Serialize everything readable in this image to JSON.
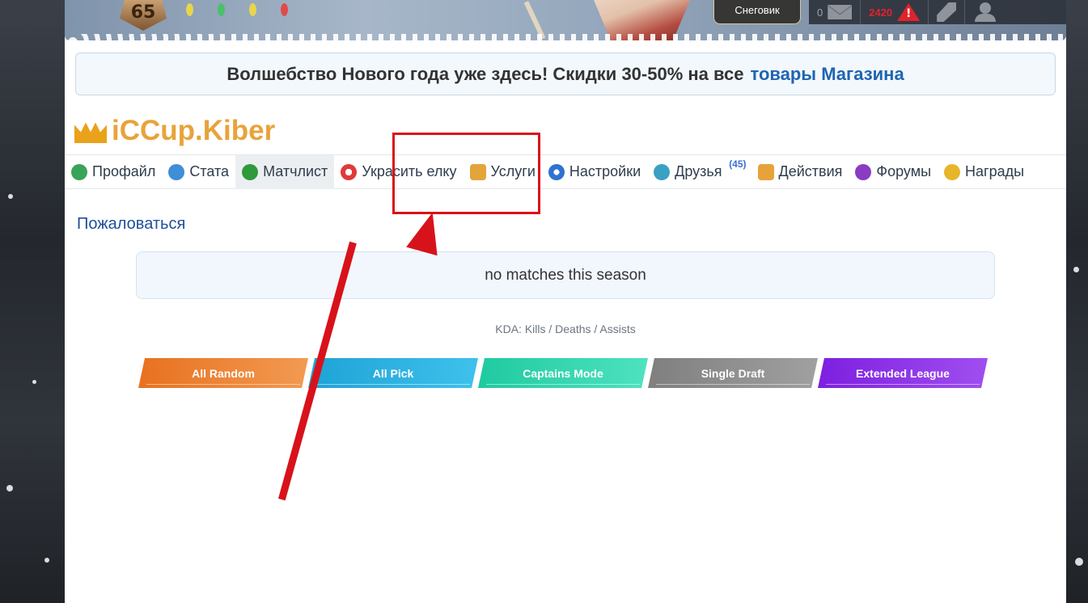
{
  "header": {
    "level": "65",
    "nickname_button": "Снеговик",
    "messages_count": "0",
    "alerts_count": "2420",
    "icons": [
      "mail-icon",
      "warning-icon",
      "wrench-icon",
      "user-icon"
    ]
  },
  "announcement": {
    "text": "Волшебство Нового года уже здесь! Скидки 30-50% на все",
    "link": "товары Магазина"
  },
  "profile": {
    "username": "iCCup.Kiber",
    "crown_icon": "crown-icon"
  },
  "tabs": [
    {
      "label": "Профайл",
      "icon": "profile-icon",
      "color": "#3aa35a"
    },
    {
      "label": "Стата",
      "icon": "stats-icon",
      "color": "#3f8ed6"
    },
    {
      "label": "Матчлист",
      "icon": "matchlist-icon",
      "color": "#2f9a3c",
      "active": true
    },
    {
      "label": "Украсить елку",
      "icon": "candy-icon",
      "color": "#e03a3a"
    },
    {
      "label": "Услуги",
      "icon": "services-icon",
      "color": "#e3a43a"
    },
    {
      "label": "Настройки",
      "icon": "settings-icon",
      "color": "#2f72d0"
    },
    {
      "label": "Друзья",
      "icon": "friends-icon",
      "color": "#3aa1c2",
      "badge": "(45)"
    },
    {
      "label": "Действия",
      "icon": "actions-icon",
      "color": "#e8a23a"
    },
    {
      "label": "Форумы",
      "icon": "forums-icon",
      "color": "#8a3cc2"
    },
    {
      "label": "Награды",
      "icon": "awards-icon",
      "color": "#e6b52a"
    }
  ],
  "main": {
    "complain_link": "Пожаловаться",
    "no_matches": "no matches this season",
    "kda_legend": "KDA: Kills / Deaths / Assists"
  },
  "modes": [
    {
      "label": "All Random",
      "color": "#ee7b2c"
    },
    {
      "label": "All Pick",
      "color": "#27aee0"
    },
    {
      "label": "Captains Mode",
      "color": "#27d2a8"
    },
    {
      "label": "Single Draft",
      "color": "#8c8c8c"
    },
    {
      "label": "Extended League",
      "color": "#8a2de6"
    }
  ],
  "colors": {
    "annotation": "#d8121b",
    "username": "#e8a33a",
    "link": "#1f64b2"
  }
}
